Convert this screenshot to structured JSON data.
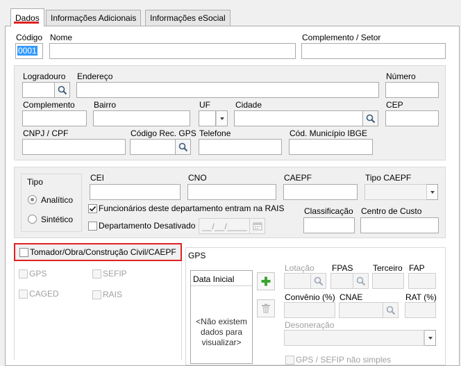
{
  "tabs": [
    {
      "label": "Dados"
    },
    {
      "label": "Informações Adicionais"
    },
    {
      "label": "Informações eSocial"
    }
  ],
  "header": {
    "codigo_label": "Código",
    "codigo_value": "0001",
    "nome_label": "Nome",
    "complemento_setor_label": "Complemento / Setor"
  },
  "address": {
    "logradouro_label": "Logradouro",
    "endereco_label": "Endereço",
    "numero_label": "Número",
    "complemento_label": "Complemento",
    "bairro_label": "Bairro",
    "uf_label": "UF",
    "cidade_label": "Cidade",
    "cep_label": "CEP",
    "cnpj_label": "CNPJ / CPF",
    "codigo_rec_gps_label": "Código Rec. GPS",
    "telefone_label": "Telefone",
    "cod_municipio_label": "Cód. Município IBGE"
  },
  "tipo": {
    "group_label": "Tipo",
    "analitico_label": "Analítico",
    "sintetico_label": "Sintético",
    "selected": "Analítico"
  },
  "fiscal": {
    "cei_label": "CEI",
    "cno_label": "CNO",
    "caepf_label": "CAEPF",
    "tipo_caepf_label": "Tipo CAEPF",
    "rais_check_label": "Funcionários deste departamento entram na RAIS",
    "rais_checked": true,
    "desativado_label": "Departamento Desativado",
    "date_placeholder": "__/__/____",
    "classificacao_label": "Classificação",
    "centro_custo_label": "Centro de Custo"
  },
  "tomador": {
    "check_label": "Tomador/Obra/Construção Civil/CAEPF",
    "highlight_color": "#e02020",
    "gps_label": "GPS",
    "sefip_label": "SEFIP",
    "caged_label": "CAGED",
    "rais_label": "RAIS"
  },
  "gps": {
    "group_label": "GPS",
    "list_header": "Data Inicial",
    "empty_message": "<Não existem dados para visualizar>",
    "lotacao_label": "Lotação",
    "fpas_label": "FPAS",
    "terceiro_label": "Terceiro",
    "fap_label": "FAP",
    "convenio_label": "Convênio (%)",
    "cnae_label": "CNAE",
    "rat_label": "RAT (%)",
    "desoneracao_label": "Desoneração",
    "gps_sefip_label": "GPS / SEFIP não simples"
  },
  "colors": {
    "tab_underline": "#e02020",
    "add_icon": "#3aa52e",
    "selection": "#3399ff"
  }
}
